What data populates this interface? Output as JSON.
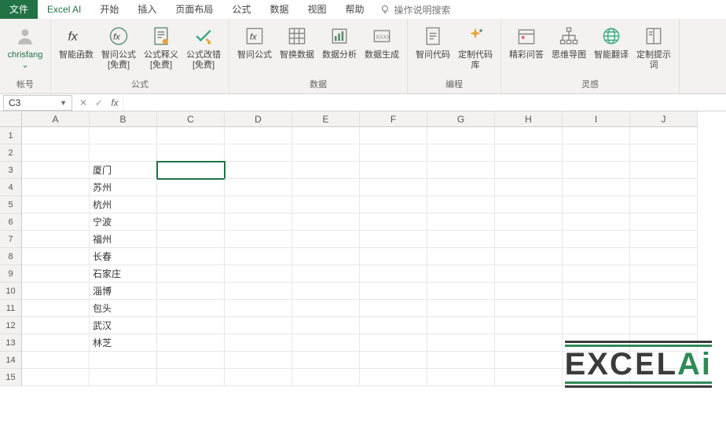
{
  "tabs": {
    "file": "文件",
    "items": [
      "Excel AI",
      "开始",
      "插入",
      "页面布局",
      "公式",
      "数据",
      "视图",
      "帮助"
    ],
    "active_index": 0,
    "search_hint": "操作说明搜索"
  },
  "ribbon": {
    "groups": [
      {
        "label": "帐号",
        "items": [
          {
            "name": "account",
            "label": "chrisfang\n⌄",
            "icon": "user-icon"
          }
        ]
      },
      {
        "label": "公式",
        "items": [
          {
            "name": "smart-function",
            "label": "智能函数",
            "icon": "fx-icon"
          },
          {
            "name": "smart-formula",
            "label": "智问公式\n[免费]",
            "icon": "fx-circle-icon"
          },
          {
            "name": "formula-explain",
            "label": "公式释义\n[免费]",
            "icon": "doc-explain-icon"
          },
          {
            "name": "formula-debug",
            "label": "公式改错\n[免费]",
            "icon": "check-warn-icon"
          }
        ]
      },
      {
        "label": "数据",
        "items": [
          {
            "name": "smart-formula2",
            "label": "智问公式",
            "icon": "fx-box-icon"
          },
          {
            "name": "swap-data",
            "label": "智换数据",
            "icon": "grid-icon"
          },
          {
            "name": "data-analyze",
            "label": "数据分析",
            "icon": "bars-icon"
          },
          {
            "name": "data-generate",
            "label": "数据生成",
            "icon": "xxxx-icon"
          }
        ]
      },
      {
        "label": "编程",
        "items": [
          {
            "name": "smart-code",
            "label": "智问代码",
            "icon": "code-doc-icon"
          },
          {
            "name": "custom-lib",
            "label": "定制代码库",
            "icon": "sparkle-icon"
          }
        ]
      },
      {
        "label": "灵感",
        "items": [
          {
            "name": "qa",
            "label": "精彩问答",
            "icon": "calendar-icon"
          },
          {
            "name": "mindmap",
            "label": "思维导图",
            "icon": "tree-icon"
          },
          {
            "name": "translate",
            "label": "智能翻译",
            "icon": "globe-icon"
          },
          {
            "name": "custom-prompt",
            "label": "定制提示词",
            "icon": "book-icon"
          }
        ]
      }
    ]
  },
  "formula_bar": {
    "cell_ref": "C3",
    "value": ""
  },
  "sheet": {
    "columns": [
      "A",
      "B",
      "C",
      "D",
      "E",
      "F",
      "G",
      "H",
      "I",
      "J"
    ],
    "row_count": 15,
    "active_cell": {
      "row": 3,
      "col": "C"
    },
    "data": {
      "B3": "厦门",
      "B4": "苏州",
      "B5": "杭州",
      "B6": "宁波",
      "B7": "福州",
      "B8": "长春",
      "B9": "石家庄",
      "B10": "淄博",
      "B11": "包头",
      "B12": "武汉",
      "B13": "林芝"
    }
  },
  "watermark": {
    "text1": "EXC",
    "text2": "E",
    "text3": "L",
    "text4": "Ai"
  }
}
